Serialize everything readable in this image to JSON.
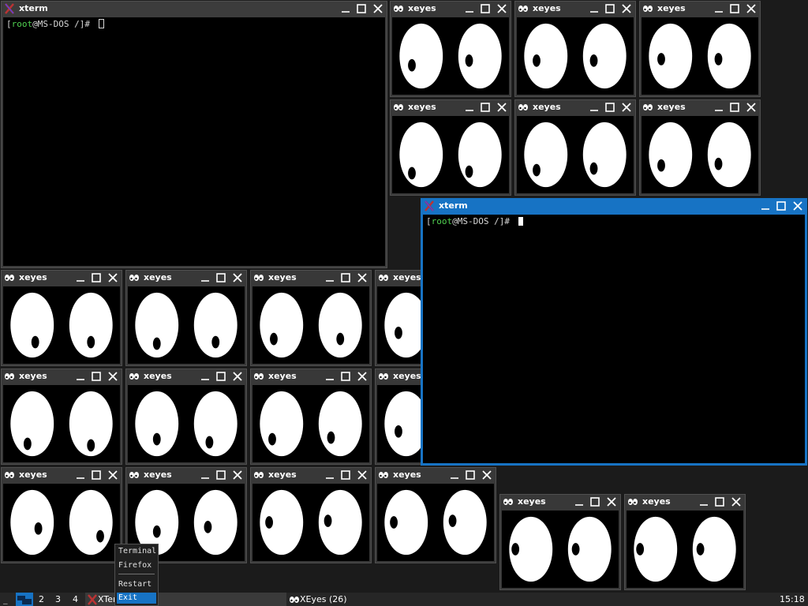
{
  "windows": {
    "xterm_main": {
      "title": "xterm",
      "prompt_user": "root",
      "prompt_rest": "@MS-DOS /]# ",
      "prompt_open": "["
    },
    "xterm_active": {
      "title": "xterm",
      "prompt_user": "root",
      "prompt_rest": "@MS-DOS /]# ",
      "prompt_open": "["
    },
    "xeyes_title": "xeyes"
  },
  "taskbar": {
    "workspaces": [
      "2",
      "3",
      "4"
    ],
    "tasks": {
      "xterm": "XTerm",
      "xeyes": "XEyes (26)"
    },
    "clock": "15:18"
  },
  "menu": {
    "items": [
      "Terminal",
      "Firefox",
      "Restart",
      "Exit"
    ],
    "selected": "Exit"
  },
  "colors": {
    "active_border": "#1773c4",
    "prompt_user": "#50d050",
    "desktop": "#1b1b1b"
  }
}
